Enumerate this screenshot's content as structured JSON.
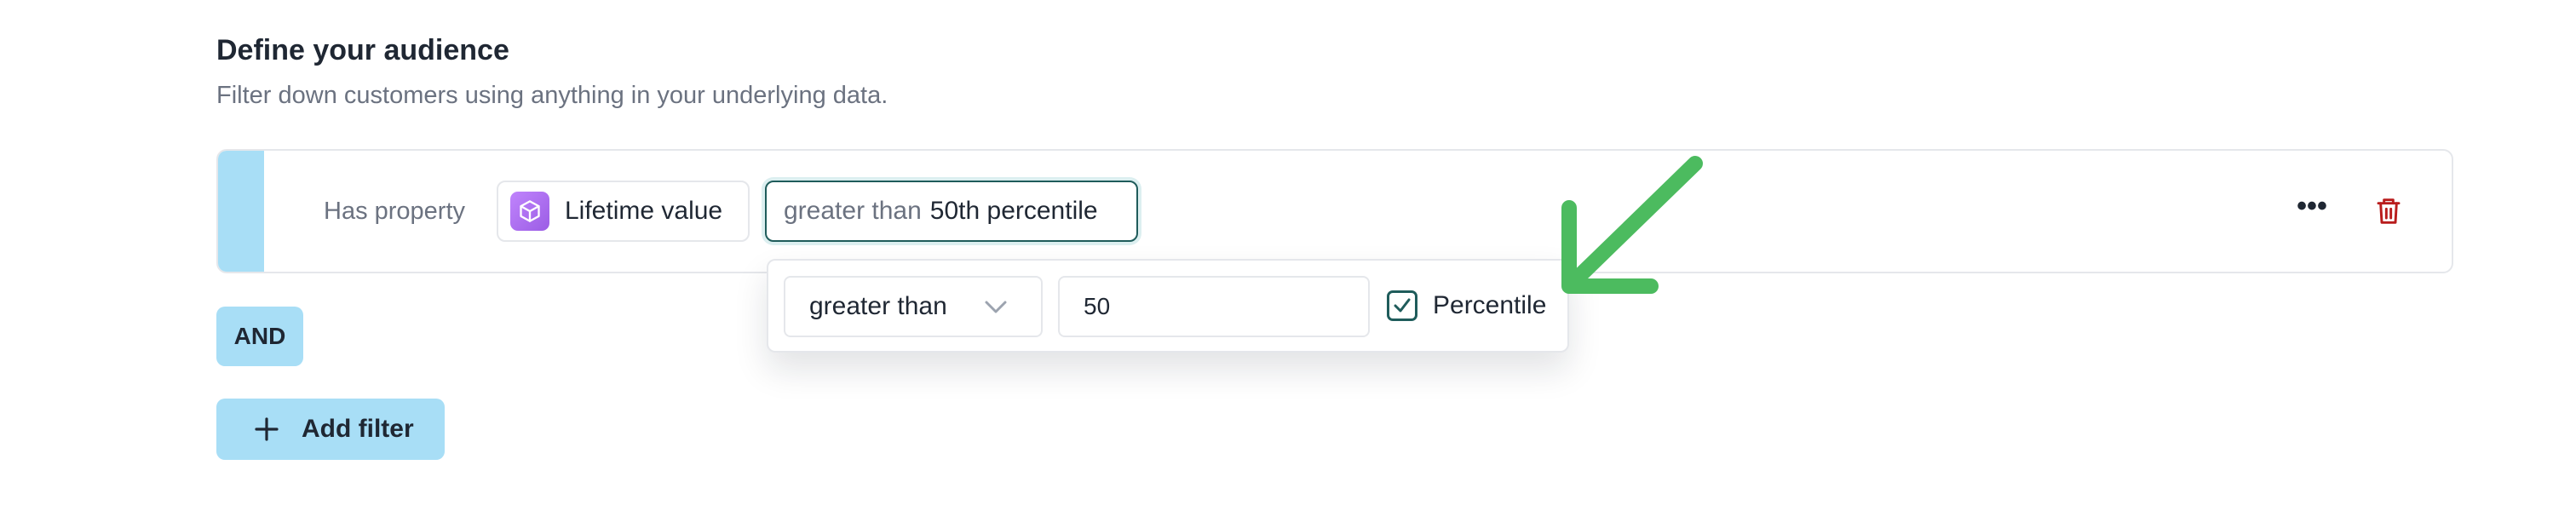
{
  "section": {
    "title": "Define your audience",
    "subtitle": "Filter down customers using anything in your underlying data."
  },
  "filter": {
    "prefix": "Has property",
    "property": {
      "label": "Lifetime value",
      "icon": "cube-icon"
    },
    "condition": {
      "operator": "greater than",
      "value": "50th percentile"
    },
    "more_icon": "more-horizontal-icon",
    "delete_icon": "trash-icon"
  },
  "popover": {
    "operator_selected": "greater than",
    "value": "50",
    "percentile_label": "Percentile",
    "percentile_checked": true
  },
  "logic": {
    "conjunction": "AND"
  },
  "actions": {
    "add_filter_label": "Add filter"
  },
  "colors": {
    "accent": "#a8def6",
    "focus_border": "#1f5c5b",
    "property_badge": "#a66bf0",
    "delete": "#b91c1c",
    "annotation_arrow": "#4cbb5f"
  }
}
